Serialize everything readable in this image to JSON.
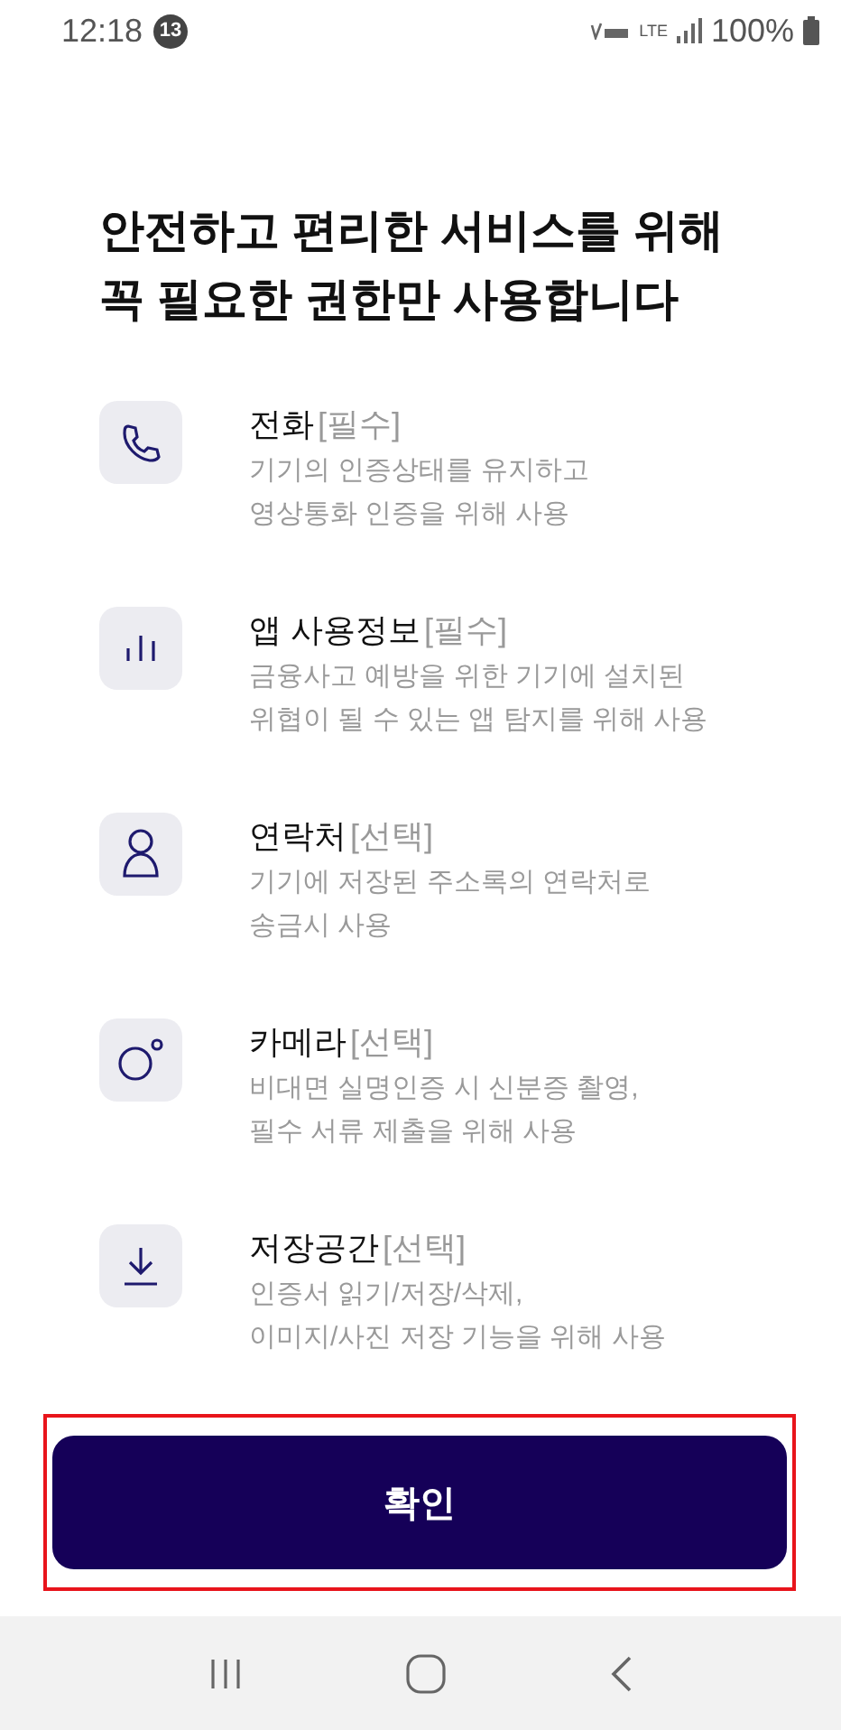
{
  "status_bar": {
    "time": "12:18",
    "notification_count": "13",
    "network": "LTE",
    "battery": "100%"
  },
  "heading": [
    "안전하고 편리한 서비스를 위해",
    "꼭 필요한 권한만 사용합니다"
  ],
  "permissions": [
    {
      "kind": "phone",
      "name": "전화",
      "tag": "[필수]",
      "description": [
        "기기의 인증상태를 유지하고",
        "영상통화 인증을 위해 사용"
      ]
    },
    {
      "kind": "chart",
      "name": "앱 사용정보",
      "tag": "[필수]",
      "description": [
        "금융사고 예방을 위한 기기에 설치된",
        "위협이 될 수 있는 앱 탐지를 위해 사용"
      ]
    },
    {
      "kind": "person",
      "name": "연락처",
      "tag": "[선택]",
      "description": [
        "기기에 저장된 주소록의 연락처로",
        "송금시 사용"
      ]
    },
    {
      "kind": "camera",
      "name": "카메라",
      "tag": "[선택]",
      "description": [
        "비대면 실명인증 시 신분증 촬영,",
        "필수 서류 제출을 위해 사용"
      ]
    },
    {
      "kind": "download",
      "name": "저장공간",
      "tag": "[선택]",
      "description": [
        "인증서 읽기/저장/삭제,",
        "이미지/사진 저장 기능을 위해 사용"
      ]
    }
  ],
  "confirm_button": {
    "label": "확인",
    "highlighted": true
  }
}
